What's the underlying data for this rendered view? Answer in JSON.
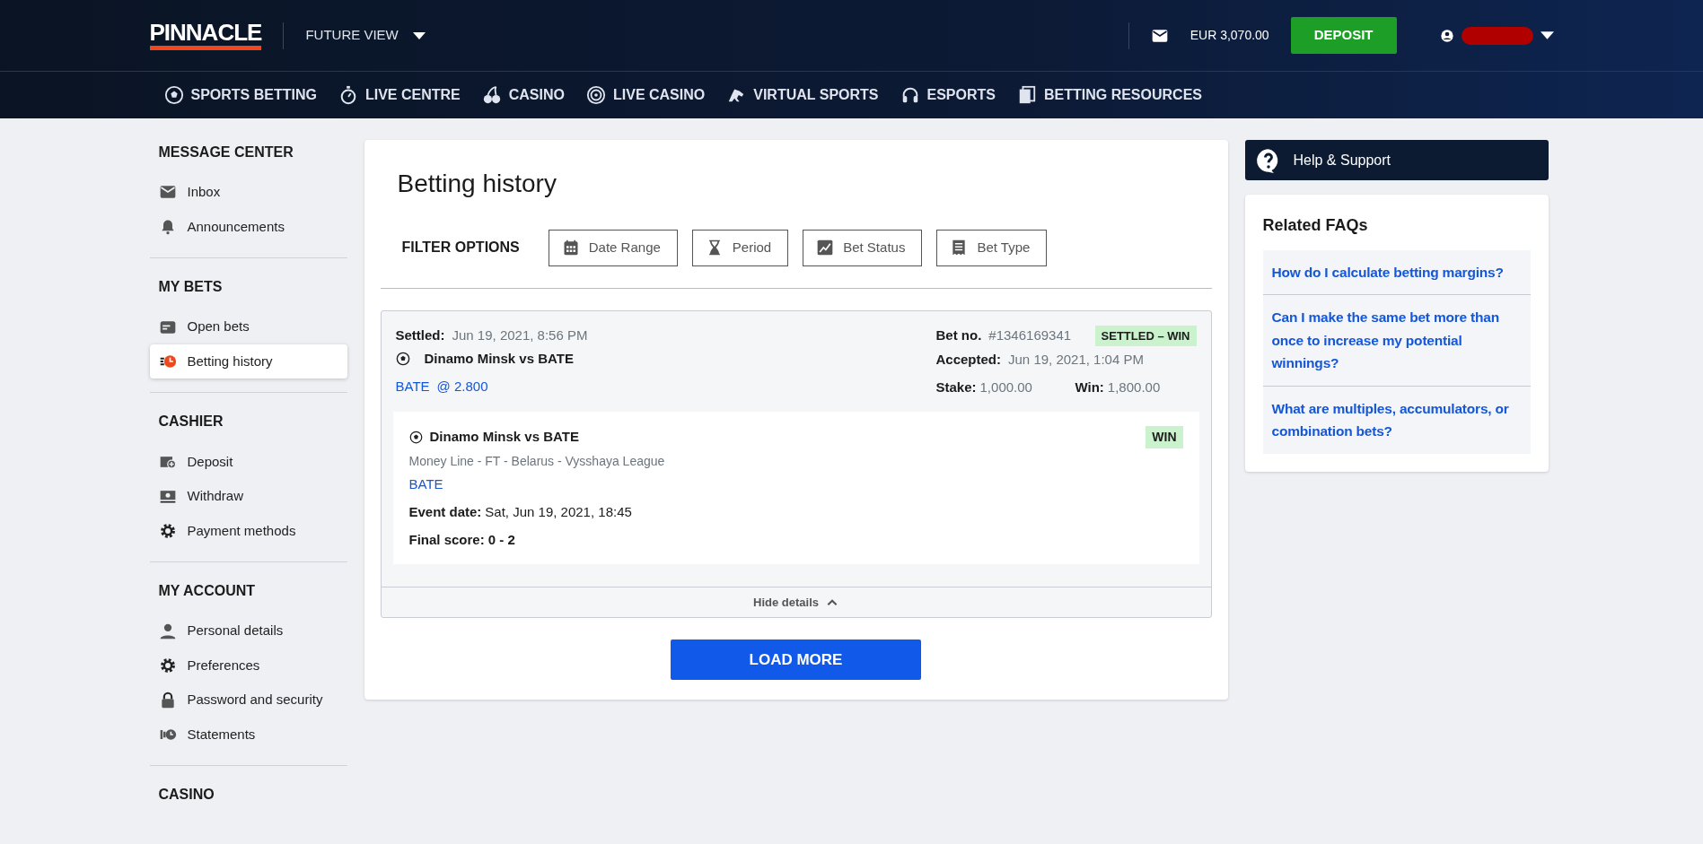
{
  "header": {
    "logo": "PINNACLE",
    "view_selector": "FUTURE VIEW",
    "balance": "EUR 3,070.00",
    "deposit_button": "DEPOSIT"
  },
  "nav": [
    "SPORTS BETTING",
    "LIVE CENTRE",
    "CASINO",
    "LIVE CASINO",
    "VIRTUAL SPORTS",
    "ESPORTS",
    "BETTING RESOURCES"
  ],
  "sidebar": {
    "sections": [
      {
        "title": "MESSAGE CENTER",
        "items": [
          {
            "label": "Inbox",
            "selected": false
          },
          {
            "label": "Announcements",
            "selected": false
          }
        ]
      },
      {
        "title": "MY BETS",
        "items": [
          {
            "label": "Open bets",
            "selected": false
          },
          {
            "label": "Betting history",
            "selected": true
          }
        ]
      },
      {
        "title": "CASHIER",
        "items": [
          {
            "label": "Deposit",
            "selected": false
          },
          {
            "label": "Withdraw",
            "selected": false
          },
          {
            "label": "Payment methods",
            "selected": false
          }
        ]
      },
      {
        "title": "MY ACCOUNT",
        "items": [
          {
            "label": "Personal details",
            "selected": false
          },
          {
            "label": "Preferences",
            "selected": false
          },
          {
            "label": "Password and security",
            "selected": false
          },
          {
            "label": "Statements",
            "selected": false
          }
        ]
      },
      {
        "title": "CASINO"
      }
    ]
  },
  "main": {
    "title": "Betting history",
    "filter_label": "FILTER OPTIONS",
    "filters": [
      "Date Range",
      "Period",
      "Bet Status",
      "Bet Type"
    ],
    "bet": {
      "settled_label": "Settled:",
      "settled": "Jun 19, 2021, 8:56 PM",
      "event": "Dinamo Minsk vs BATE",
      "selection": "BATE",
      "odds": "@ 2.800",
      "bet_no_label": "Bet no.",
      "bet_no": "#1346169341",
      "status": "SETTLED – WIN",
      "accepted_label": "Accepted:",
      "accepted": "Jun 19, 2021, 1:04 PM",
      "stake_label": "Stake:",
      "stake": "1,000.00",
      "win_label": "Win:",
      "win": "1,800.00",
      "expanded": true,
      "details": {
        "event": "Dinamo Minsk vs BATE",
        "market": "Money Line - FT - Belarus - Vysshaya League",
        "selection": "BATE",
        "result": "WIN",
        "event_date_label": "Event date:",
        "event_date": "Sat, Jun 19, 2021, 18:45",
        "final_score_label": "Final score:",
        "final_score": "0 - 2"
      },
      "hide_details": "Hide details"
    },
    "load_more": "LOAD MORE"
  },
  "aside": {
    "help": "Help & Support",
    "faq_title": "Related FAQs",
    "faqs": [
      "How do I calculate betting margins?",
      "Can I make the same bet more than once to increase my potential winnings?",
      "What are multiples, accumulators, or combination bets?"
    ]
  }
}
